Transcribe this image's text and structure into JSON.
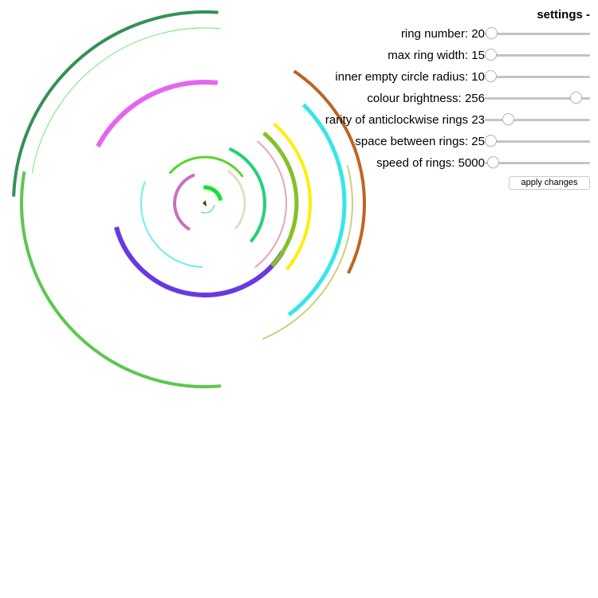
{
  "settings": {
    "title": "settings -",
    "apply_label": "apply changes",
    "controls": [
      {
        "label": "ring number: 20",
        "fraction": 0.01
      },
      {
        "label": "max ring width: 15",
        "fraction": 0.0
      },
      {
        "label": "inner empty circle radius: 10",
        "fraction": 0.0
      },
      {
        "label": "colour brightness: 256",
        "fraction": 0.92
      },
      {
        "label": "rarity of anticlockwise rings 23",
        "fraction": 0.19
      },
      {
        "label": "space between rings: 25",
        "fraction": 0.0
      },
      {
        "label": "speed of rings: 5000",
        "fraction": 0.03
      }
    ]
  },
  "rings": [
    {
      "color": "#444400",
      "startDeg": 150,
      "endDeg": 210
    },
    {
      "color": "#35c0b0",
      "startDeg": 10,
      "endDeg": 115
    },
    {
      "color": "#11e42c",
      "startDeg": -95,
      "endDeg": -10
    },
    {
      "color": "#c770c2",
      "startDeg": 120,
      "endDeg": 250
    },
    {
      "color": "#5bd42b",
      "startDeg": -140,
      "endDeg": -35
    },
    {
      "color": "#e8dcc3",
      "startDeg": -55,
      "endDeg": 40
    },
    {
      "color": "#6cefec",
      "startDeg": 92,
      "endDeg": 200
    },
    {
      "color": "#26d078",
      "startDeg": -66,
      "endDeg": 40
    },
    {
      "color": "#6938e4",
      "startDeg": 32,
      "endDeg": 165
    },
    {
      "color": "#eaa3bc",
      "startDeg": -50,
      "endDeg": 52
    },
    {
      "color": "#86c026",
      "startDeg": -50,
      "endDeg": 43
    },
    {
      "color": "#ffee00",
      "startDeg": -49,
      "endDeg": 39
    },
    {
      "color": "#e466f0",
      "startDeg": -84,
      "endDeg": -152
    },
    {
      "color": "#38e6e8",
      "startDeg": -45,
      "endDeg": 53
    },
    {
      "color": "#bf6423",
      "startDeg": -56,
      "endDeg": 26
    },
    {
      "color": "#d2cc80",
      "startDeg": -15,
      "endDeg": 67
    },
    {
      "color": "#6ee67a",
      "startDeg": -85,
      "endDeg": -170
    },
    {
      "color": "#5bc84e",
      "startDeg": 85,
      "endDeg": 190
    },
    {
      "color": "#339155",
      "startDeg": -86,
      "endDeg": -178
    }
  ]
}
